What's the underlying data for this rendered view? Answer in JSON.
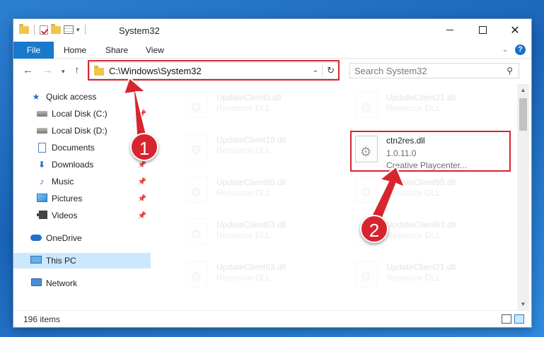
{
  "window": {
    "title": "System32",
    "controls": {
      "minimize": "",
      "maximize": "",
      "close": "✕"
    }
  },
  "ribbon": {
    "tabs": [
      "File",
      "Home",
      "Share",
      "View"
    ],
    "help": "?"
  },
  "navigation": {
    "address": "C:\\Windows\\System32",
    "search_placeholder": "Search System32"
  },
  "sidebar": {
    "items": [
      {
        "label": "Quick access",
        "icon": "star-icon",
        "pinned": false
      },
      {
        "label": "Local Disk (C:)",
        "icon": "drive-icon",
        "pinned": true
      },
      {
        "label": "Local Disk (D:)",
        "icon": "drive-icon",
        "pinned": true
      },
      {
        "label": "Documents",
        "icon": "document-icon",
        "pinned": true
      },
      {
        "label": "Downloads",
        "icon": "download-icon",
        "pinned": true
      },
      {
        "label": "Music",
        "icon": "music-icon",
        "pinned": true
      },
      {
        "label": "Pictures",
        "icon": "pictures-icon",
        "pinned": true
      },
      {
        "label": "Videos",
        "icon": "videos-icon",
        "pinned": true
      },
      {
        "label": "OneDrive",
        "icon": "cloud-icon",
        "pinned": false
      },
      {
        "label": "This PC",
        "icon": "computer-icon",
        "pinned": false,
        "selected": true
      },
      {
        "label": "Network",
        "icon": "network-icon",
        "pinned": false
      }
    ]
  },
  "files": {
    "left_column": [
      {
        "name": "UpdateClient5.dll",
        "desc": "Resource DLL"
      },
      {
        "name": "UpdateClient19.dll",
        "desc": "Resource DLL"
      },
      {
        "name": "UpdateClient65.dll",
        "desc": "Resource DLL"
      },
      {
        "name": "UpdateClient63.dll",
        "desc": "Resource DLL"
      },
      {
        "name": "UpdateClient63.dll",
        "desc": "Resource DLL"
      }
    ],
    "right_column": [
      {
        "name": "UpdateClient21.dll",
        "desc": "Resource DLL"
      },
      {
        "name": "UpdateClient65.dll",
        "desc": "Resource DLL"
      },
      {
        "name": "UpdateClient63.dll",
        "desc": "Resource DLL"
      },
      {
        "name": "UpdateClient21.dll",
        "desc": "Resource DLL"
      }
    ],
    "highlighted": {
      "name": "ctn2res.dll",
      "version": "1.0.11.0",
      "desc": "Creative Playcenter..."
    }
  },
  "status": {
    "item_count": "196 items"
  },
  "annotations": {
    "step1": "1",
    "step2": "2",
    "color": "#d7252f"
  }
}
